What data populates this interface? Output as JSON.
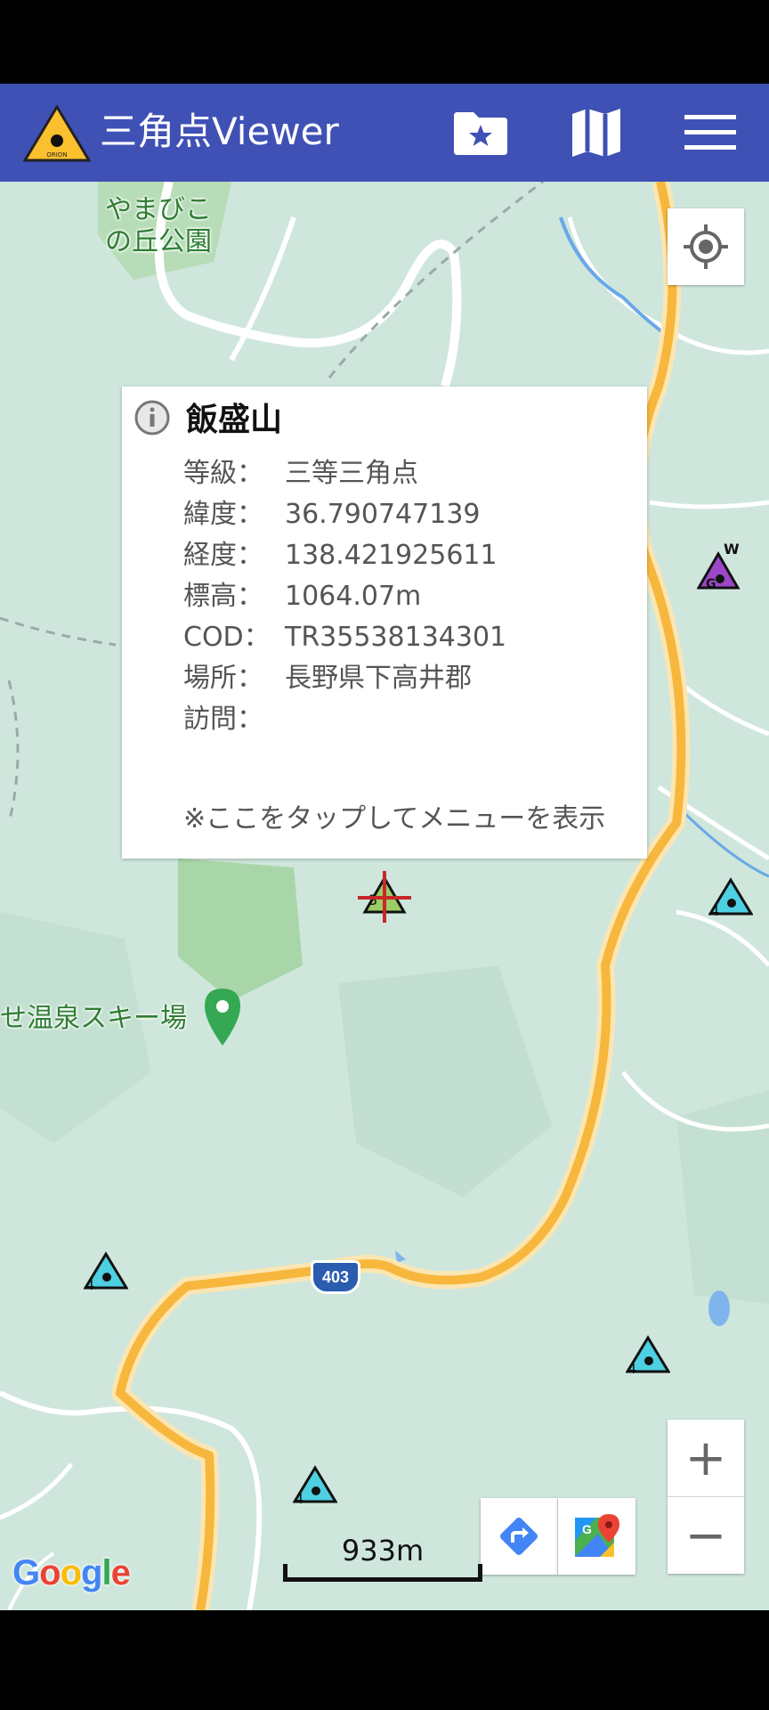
{
  "app_bar": {
    "title": "三角点Viewer",
    "logo_text": "ORION",
    "icons": [
      "folder-star-icon",
      "map-icon",
      "menu-icon"
    ]
  },
  "map": {
    "labels": {
      "park_line1": "やまびこ",
      "park_line2": "の丘公園",
      "ski_area": "せ温泉スキー場",
      "route_number": "403"
    },
    "markers": {
      "selected_digit": "3",
      "grade4_digit": "4",
      "gps_letter_g": "G",
      "gps_letter_w": "W"
    },
    "scale_text": "933m",
    "attribution": "Google"
  },
  "popup": {
    "title": "飯盛山",
    "rows": [
      {
        "label": "等級：",
        "value": "三等三角点"
      },
      {
        "label": "緯度：",
        "value": "36.790747139"
      },
      {
        "label": "経度：",
        "value": "138.421925611"
      },
      {
        "label": "標高：",
        "value": "1064.07m"
      },
      {
        "label": "COD：",
        "value": "TR35538134301"
      },
      {
        "label": "場所：",
        "value": "長野県下高井郡"
      },
      {
        "label": "訪問：",
        "value": ""
      }
    ],
    "footer": "※ここをタップしてメニューを表示"
  },
  "controls": {
    "zoom_in": "+",
    "zoom_out": "−"
  },
  "colors": {
    "app_bar": "#3f51b5",
    "map_bg": "#cfe6dc",
    "road_major": "#f6b73c",
    "marker_grade4": "#4dd0e1",
    "marker_gps": "#9c47c9",
    "marker_grade3": "#9ccc65"
  }
}
